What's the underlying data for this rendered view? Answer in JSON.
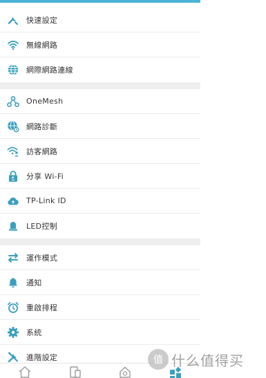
{
  "colors": {
    "accent": "#3a9fbf",
    "top_bar": "#4cb3d4",
    "tab_active": "#3a9fbf",
    "tab_inactive": "#9a9a9a"
  },
  "groups": [
    {
      "items": [
        {
          "label": "快速設定",
          "icon": "wrench-icon"
        },
        {
          "label": "無線網路",
          "icon": "wifi-icon"
        },
        {
          "label": "網際網路連線",
          "icon": "globe-icon"
        }
      ]
    },
    {
      "items": [
        {
          "label": "OneMesh",
          "icon": "mesh-icon"
        },
        {
          "label": "網路診斷",
          "icon": "globe-diagnose-icon"
        },
        {
          "label": "訪客網路",
          "icon": "guest-wifi-icon"
        },
        {
          "label": "分享 Wi-Fi",
          "icon": "share-lock-icon"
        },
        {
          "label": "TP-Link ID",
          "icon": "cloud-icon"
        },
        {
          "label": "LED控制",
          "icon": "led-icon"
        }
      ]
    },
    {
      "items": [
        {
          "label": "運作模式",
          "icon": "swap-arrows-icon"
        },
        {
          "label": "通知",
          "icon": "bell-icon"
        },
        {
          "label": "重啟排程",
          "icon": "alarm-clock-icon"
        },
        {
          "label": "系統",
          "icon": "gear-icon"
        },
        {
          "label": "進階設定",
          "icon": "tools-icon"
        }
      ]
    }
  ],
  "tabs": [
    {
      "icon": "home-tab-icon",
      "active": false
    },
    {
      "icon": "devices-tab-icon",
      "active": false
    },
    {
      "icon": "security-tab-icon",
      "active": false
    },
    {
      "icon": "tools-tab-icon",
      "active": true
    }
  ],
  "watermark": {
    "logo": "值",
    "text": "什么值得买"
  }
}
